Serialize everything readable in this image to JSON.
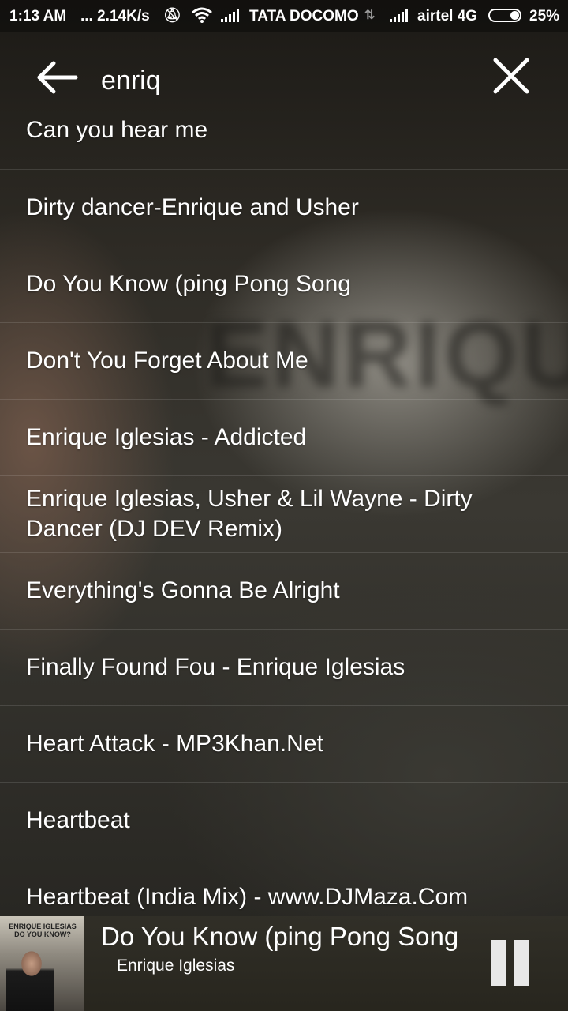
{
  "status_bar": {
    "time": "1:13 AM",
    "speed": "... 2.14K/s",
    "carrier1": "TATA DOCOMO",
    "carrier2": "airtel 4G",
    "battery": "25%",
    "icons": [
      "mute-alarm-icon",
      "wifi-icon",
      "signal-icon",
      "data-arrows-icon",
      "signal-icon",
      "battery-icon"
    ]
  },
  "search": {
    "query": "enriq"
  },
  "results": [
    "Can you hear me",
    "Dirty dancer-Enrique and Usher",
    "Do You Know (ping Pong Song",
    "Don't You Forget About Me",
    "Enrique Iglesias - Addicted",
    "Enrique Iglesias, Usher & Lil Wayne - Dirty Dancer (DJ DEV Remix)",
    "Everything's Gonna Be Alright",
    "Finally Found Fou - Enrique Iglesias",
    "Heart Attack - MP3Khan.Net",
    "Heartbeat",
    "Heartbeat (India Mix) - www.DJMaza.Com"
  ],
  "now_playing": {
    "title": "Do You Know (ping Pong Song",
    "artist": "Enrique Iglesias",
    "album_art_text": "ENRIQUE IGLESIAS DO YOU KNOW?"
  },
  "colors": {
    "text": "#ffffff",
    "divider": "rgba(255,255,255,0.12)"
  }
}
